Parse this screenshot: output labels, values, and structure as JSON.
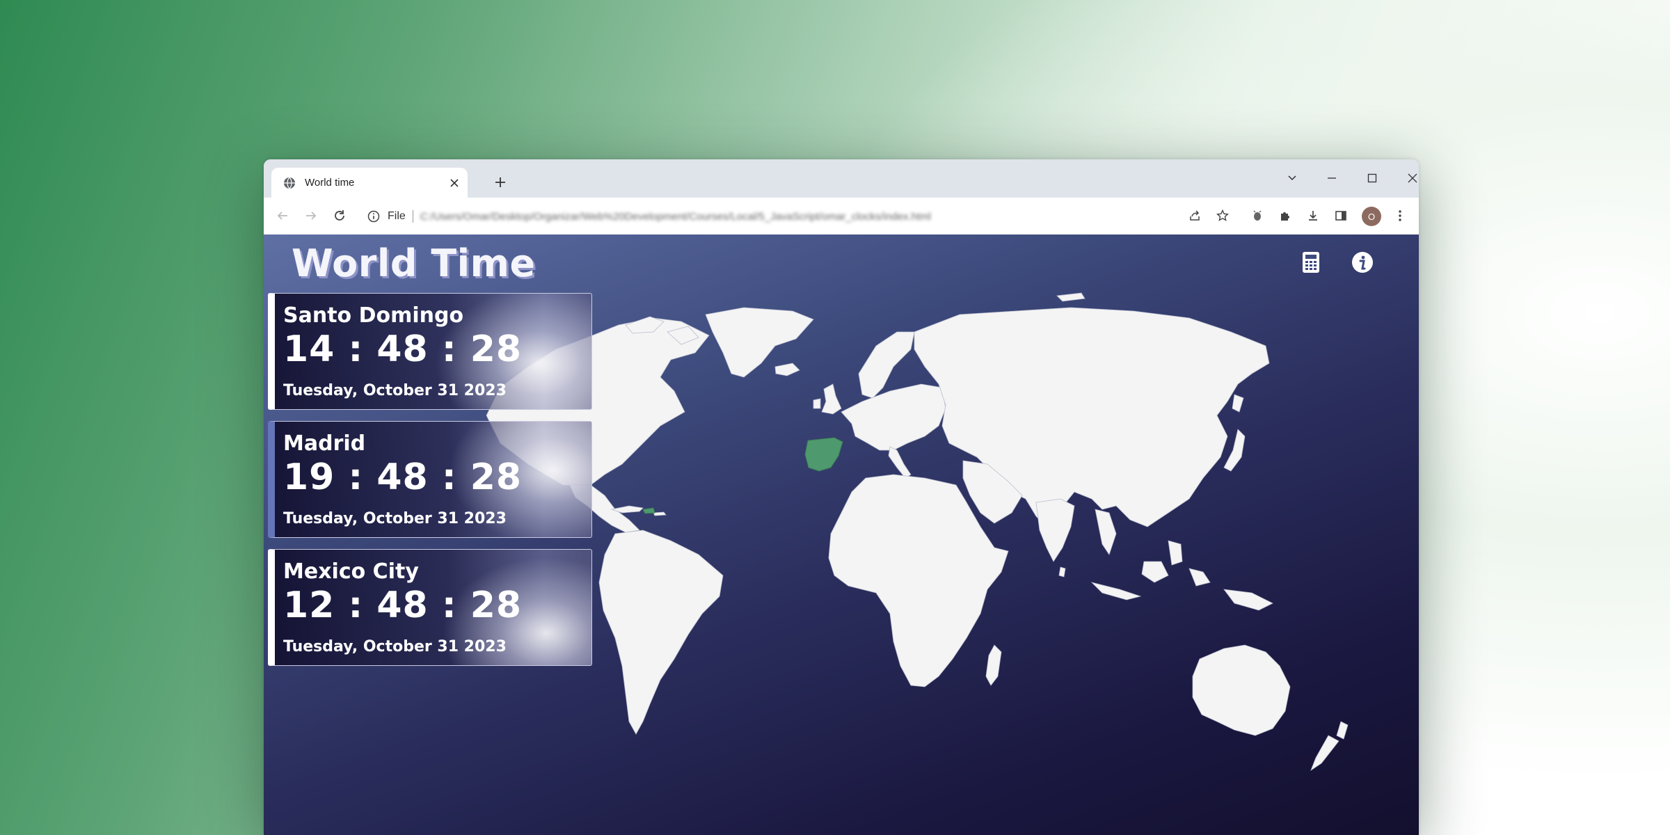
{
  "browser": {
    "tab_title": "World time",
    "address_scheme": "File",
    "address_url": "C:/Users/Omar/Desktop/Organizar/Web%20Development/Courses/Local/5_JavaScript/omar_clocks/index.html",
    "profile_initial": "O",
    "icons": {
      "tab": "globe-icon",
      "close": "close-icon",
      "new_tab": "plus-icon",
      "back": "back-arrow-icon",
      "forward": "forward-arrow-icon",
      "reload": "reload-icon",
      "site_info": "info-icon",
      "share": "share-icon",
      "bookmark": "star-icon",
      "extension": "extension-icon",
      "puzzle": "puzzle-icon",
      "download": "download-icon",
      "side_panel": "side-panel-icon",
      "menu": "kebab-menu-icon"
    }
  },
  "app": {
    "title": "World Time",
    "icons": {
      "calculator": "calculator-icon",
      "info": "info-circle-icon"
    },
    "highlight_color": "#4e9a6e",
    "land_color": "#f4f4f4",
    "clocks": [
      {
        "city": "Santo Domingo",
        "time": "14 : 48 : 28",
        "date": "Tuesday, October 31 2023",
        "active": false
      },
      {
        "city": "Madrid",
        "time": "19 : 48 : 28",
        "date": "Tuesday, October 31 2023",
        "active": true
      },
      {
        "city": "Mexico City",
        "time": "12 : 48 : 28",
        "date": "Tuesday, October 31 2023",
        "active": false
      }
    ]
  }
}
